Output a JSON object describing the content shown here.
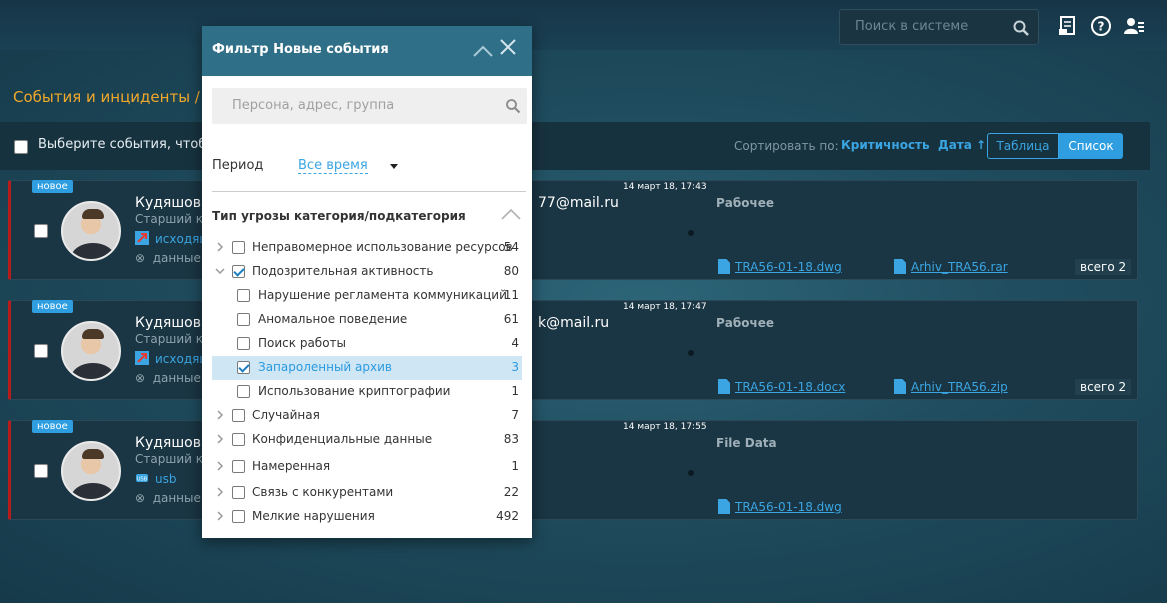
{
  "header": {
    "search_placeholder": "Поиск в системе",
    "icons": [
      "report-icon",
      "help-icon",
      "user-settings-icon"
    ]
  },
  "breadcrumb": "События и инциденты / Н",
  "toolbar": {
    "select_text": "Выберите события, чтобы",
    "sort_label": "Сортировать по:",
    "sort_criticality": "Критичность",
    "sort_date": "Дата ↑",
    "view_table": "Таблица",
    "view_list": "Список"
  },
  "events": [
    {
      "badge": "новое",
      "name": "Кудяшов А",
      "role": "Старший кон",
      "channel": "исходящ",
      "channel_icon": "outgoing-mail-icon",
      "data_label": "данные",
      "email": "77@mail.ru",
      "time": "14 март 18, 17:43",
      "status": "Рабочее",
      "files": [
        "TRA56-01-18.dwg",
        "Arhiv_TRA56.rar"
      ],
      "total": "всего 2"
    },
    {
      "badge": "новое",
      "name": "Кудяшов А",
      "role": "Старший кон",
      "channel": "исходящ",
      "channel_icon": "outgoing-mail-icon",
      "data_label": "данные",
      "email": "k@mail.ru",
      "time": "14 март 18, 17:47",
      "status": "Рабочее",
      "files": [
        "TRA56-01-18.docx",
        "Arhiv_TRA56.zip"
      ],
      "total": "всего 2"
    },
    {
      "badge": "новое",
      "name": "Кудяшов А",
      "role": "Старший кон",
      "channel": "usb",
      "channel_icon": "usb-icon",
      "data_label": "данные",
      "email": "",
      "time": "14 март 18, 17:55",
      "status": "File Data",
      "files": [
        "TRA56-01-18.dwg"
      ],
      "total": ""
    }
  ],
  "filter": {
    "title": "Фильтр Новые события",
    "search_placeholder": "Персона, адрес, группа",
    "period_label": "Период",
    "period_value": "Все время",
    "section_title": "Тип угрозы категория/подкатегория",
    "items": [
      {
        "label": "Неправомерное использование ресурсов",
        "count": "54",
        "checked": false,
        "level": 0,
        "arrow": "right",
        "active": false
      },
      {
        "label": "Подозрительная активность",
        "count": "80",
        "checked": true,
        "level": 0,
        "arrow": "down",
        "active": false
      },
      {
        "label": "Нарушение регламента коммуникаций",
        "count": "11",
        "checked": false,
        "level": 1,
        "arrow": "",
        "active": false
      },
      {
        "label": "Аномальное поведение",
        "count": "61",
        "checked": false,
        "level": 1,
        "arrow": "",
        "active": false
      },
      {
        "label": "Поиск работы",
        "count": "4",
        "checked": false,
        "level": 1,
        "arrow": "",
        "active": false
      },
      {
        "label": "Запароленный архив",
        "count": "3",
        "checked": true,
        "level": 1,
        "arrow": "",
        "active": true
      },
      {
        "label": "Использование криптографии",
        "count": "1",
        "checked": false,
        "level": 1,
        "arrow": "",
        "active": false
      },
      {
        "label": "Случайная",
        "count": "7",
        "checked": false,
        "level": 0,
        "arrow": "right",
        "active": false
      },
      {
        "label": "Конфиденциальные данные",
        "count": "83",
        "checked": false,
        "level": 0,
        "arrow": "right",
        "active": false
      },
      {
        "label": "Намеренная",
        "count": "1",
        "checked": false,
        "level": 0,
        "arrow": "right",
        "active": false
      },
      {
        "label": "Связь с конкурентами",
        "count": "22",
        "checked": false,
        "level": 0,
        "arrow": "right",
        "active": false
      },
      {
        "label": "Мелкие нарушения",
        "count": "492",
        "checked": false,
        "level": 0,
        "arrow": "right",
        "active": false
      }
    ]
  }
}
